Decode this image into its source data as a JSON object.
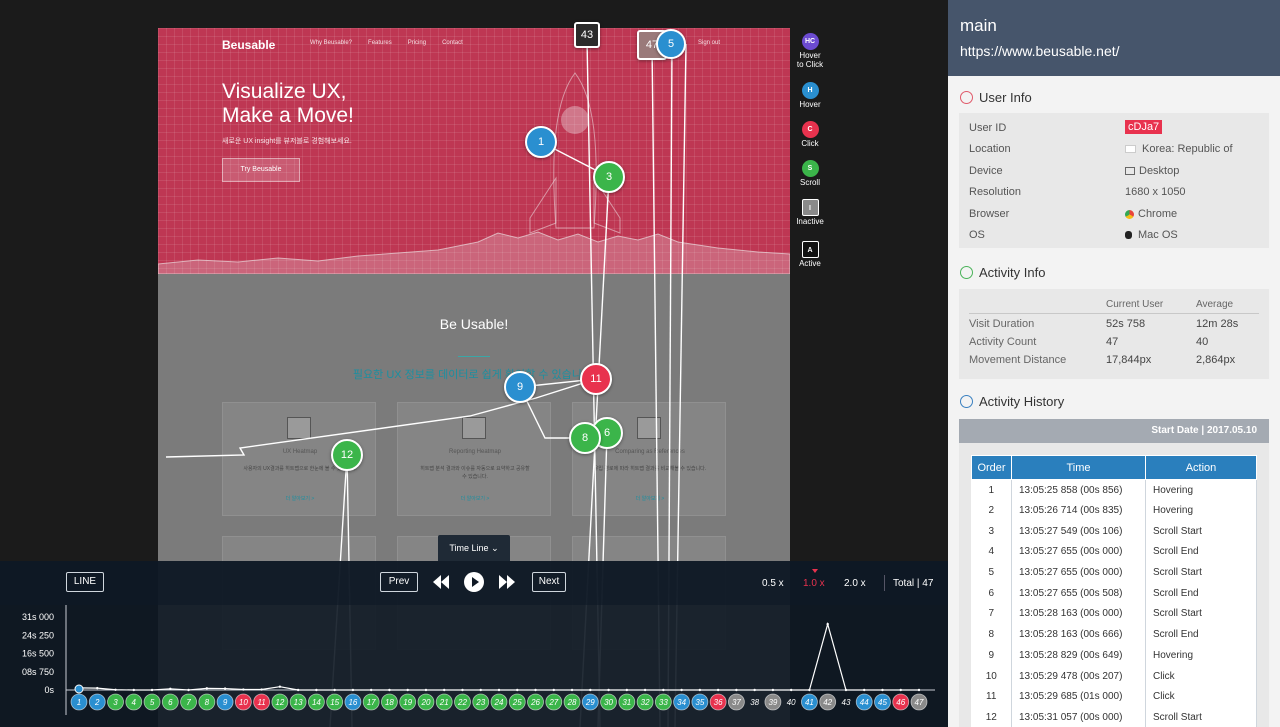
{
  "site": {
    "logo": "Beusable",
    "nav": [
      "Why Beusable?",
      "Features",
      "Pricing",
      "Contact"
    ],
    "signout": "Sign out",
    "hero_title": "Visualize UX,\nMake a Move!",
    "hero_sub": "새로운 UX insight를 뷰저블로 경험해보세요.",
    "hero_button": "Try Beusable",
    "section_title": "Be Usable!",
    "section_sub": "필요한 UX 정보를 데이터로 쉽게 확인할 수 있습니다.",
    "cards": [
      {
        "title": "UX Heatmap",
        "text": "사용자의 UX결과를 히트맵으로 한눈에 볼 수 있습니다.",
        "more": "더 알아보기 >"
      },
      {
        "title": "Reporting Heatmap",
        "text": "히트맵 분석 결과와 이슈를 자동으로 요약하고 공유할 수 있습니다.",
        "more": "더 알아보기 >"
      },
      {
        "title": "Comparing as References",
        "text": "유입 경로에 따라 히트맵 결과를 비교해볼 수 있습니다.",
        "more": "더 알아보기 >"
      }
    ]
  },
  "markers": [
    {
      "label": "43",
      "type": "inactive"
    },
    {
      "label": "47",
      "type": "inactive"
    },
    {
      "label": "5",
      "type": "hover"
    },
    {
      "label": "1",
      "type": "hover"
    },
    {
      "label": "3",
      "type": "scroll"
    },
    {
      "label": "9",
      "type": "hover"
    },
    {
      "label": "11",
      "type": "click"
    },
    {
      "label": "8",
      "type": "scroll"
    },
    {
      "label": "6",
      "type": "scroll"
    },
    {
      "label": "12",
      "type": "scroll"
    }
  ],
  "legend": [
    {
      "abbr": "HC",
      "label": "Hover\nto Click",
      "color": "#6c4bd1"
    },
    {
      "abbr": "H",
      "label": "Hover",
      "color": "#2a8fd0"
    },
    {
      "abbr": "C",
      "label": "Click",
      "color": "#e8324e"
    },
    {
      "abbr": "S",
      "label": "Scroll",
      "color": "#3bb54a"
    },
    {
      "abbr": "I",
      "label": "Inactive",
      "color": "#8a8a8a"
    },
    {
      "abbr": "A",
      "label": "Active",
      "color": "#111111"
    }
  ],
  "timeline": {
    "tab_label": "Time Line",
    "line_button": "LINE",
    "prev": "Prev",
    "next": "Next",
    "speeds": [
      "0.5 x",
      "1.0 x",
      "2.0 x"
    ],
    "total": "Total | 47",
    "y_ticks": [
      "31s 000",
      "24s 250",
      "16s 500",
      "08s 750",
      "0s"
    ]
  },
  "chart_data": {
    "type": "line",
    "title": "",
    "xlabel": "",
    "ylabel": "",
    "ylim": [
      0,
      31
    ],
    "x": [
      1,
      2,
      3,
      4,
      5,
      6,
      7,
      8,
      9,
      10,
      11,
      12,
      13,
      14,
      15,
      16,
      17,
      18,
      19,
      20,
      21,
      22,
      23,
      24,
      25,
      26,
      27,
      28,
      29,
      30,
      31,
      32,
      33,
      34,
      35,
      36,
      37,
      38,
      39,
      40,
      41,
      42,
      43,
      44,
      45,
      46,
      47
    ],
    "y_ticks": [
      "31s 000",
      "24s 250",
      "16s 500",
      "08s 750",
      "0s"
    ],
    "series": [
      {
        "values": [
          0.9,
          0.8,
          0.1,
          0,
          0,
          0.5,
          0,
          0.7,
          0.6,
          0.2,
          0.2,
          1.4,
          0,
          0,
          0,
          0,
          0,
          0,
          0,
          0,
          0,
          0,
          0,
          0,
          0,
          0,
          0,
          0,
          0,
          0,
          0,
          0,
          0,
          0,
          0,
          0,
          0,
          0,
          0,
          0,
          0,
          28,
          0,
          0,
          0,
          0,
          0
        ]
      }
    ],
    "points": [
      {
        "label": "1",
        "type": "hover"
      },
      {
        "label": "2",
        "type": "hover"
      },
      {
        "label": "3",
        "type": "scroll"
      },
      {
        "label": "4",
        "type": "scroll"
      },
      {
        "label": "5",
        "type": "scroll"
      },
      {
        "label": "6",
        "type": "scroll"
      },
      {
        "label": "7",
        "type": "scroll"
      },
      {
        "label": "8",
        "type": "scroll"
      },
      {
        "label": "9",
        "type": "hover"
      },
      {
        "label": "10",
        "type": "click"
      },
      {
        "label": "11",
        "type": "click"
      },
      {
        "label": "12",
        "type": "scroll"
      },
      {
        "label": "13",
        "type": "scroll"
      },
      {
        "label": "14",
        "type": "scroll"
      },
      {
        "label": "15",
        "type": "scroll"
      },
      {
        "label": "16",
        "type": "hover"
      },
      {
        "label": "17",
        "type": "scroll"
      },
      {
        "label": "18",
        "type": "scroll"
      },
      {
        "label": "19",
        "type": "scroll"
      },
      {
        "label": "20",
        "type": "scroll"
      },
      {
        "label": "21",
        "type": "scroll"
      },
      {
        "label": "22",
        "type": "scroll"
      },
      {
        "label": "23",
        "type": "scroll"
      },
      {
        "label": "24",
        "type": "scroll"
      },
      {
        "label": "25",
        "type": "scroll"
      },
      {
        "label": "26",
        "type": "scroll"
      },
      {
        "label": "27",
        "type": "scroll"
      },
      {
        "label": "28",
        "type": "scroll"
      },
      {
        "label": "29",
        "type": "hover"
      },
      {
        "label": "30",
        "type": "scroll"
      },
      {
        "label": "31",
        "type": "scroll"
      },
      {
        "label": "32",
        "type": "scroll"
      },
      {
        "label": "33",
        "type": "scroll"
      },
      {
        "label": "34",
        "type": "hover"
      },
      {
        "label": "35",
        "type": "hover"
      },
      {
        "label": "36",
        "type": "click"
      },
      {
        "label": "37",
        "type": "inactive"
      },
      {
        "label": "38",
        "type": "active"
      },
      {
        "label": "39",
        "type": "inactive"
      },
      {
        "label": "40",
        "type": "active"
      },
      {
        "label": "41",
        "type": "hover"
      },
      {
        "label": "42",
        "type": "inactive"
      },
      {
        "label": "43",
        "type": "active"
      },
      {
        "label": "44",
        "type": "hover"
      },
      {
        "label": "45",
        "type": "hover"
      },
      {
        "label": "46",
        "type": "click"
      },
      {
        "label": "47",
        "type": "inactive"
      }
    ]
  },
  "colors": {
    "hover": "#2a8fd0",
    "click": "#e8324e",
    "scroll": "#3bb54a",
    "inactive": "#8a8a8a",
    "active": "#111111",
    "hover_to_click": "#6c4bd1",
    "header": "#46556b",
    "table_head": "#2a7fbd"
  },
  "panel": {
    "title": "main",
    "url": "https://www.beusable.net/",
    "user_info": {
      "heading": "User Info",
      "rows": [
        {
          "label": "User ID",
          "value": "cDJa7"
        },
        {
          "label": "Location",
          "value": "Korea: Republic of"
        },
        {
          "label": "Device",
          "value": "Desktop"
        },
        {
          "label": "Resolution",
          "value": "1680 x 1050"
        },
        {
          "label": "Browser",
          "value": "Chrome"
        },
        {
          "label": "OS",
          "value": "Mac OS"
        }
      ]
    },
    "activity_info": {
      "heading": "Activity Info",
      "columns": [
        "Current User",
        "Average"
      ],
      "rows": [
        {
          "label": "Visit Duration",
          "current": "52s 758",
          "average": "12m 28s"
        },
        {
          "label": "Activity Count",
          "current": "47",
          "average": "40"
        },
        {
          "label": "Movement Distance",
          "current": "17,844px",
          "average": "2,864px"
        }
      ]
    },
    "activity_history": {
      "heading": "Activity History",
      "start_date": "Start Date | 2017.05.10",
      "columns": [
        "Order",
        "Time",
        "Action"
      ],
      "rows": [
        [
          "1",
          "13:05:25 858 (00s 856)",
          "Hovering"
        ],
        [
          "2",
          "13:05:26 714 (00s 835)",
          "Hovering"
        ],
        [
          "3",
          "13:05:27 549 (00s 106)",
          "Scroll Start"
        ],
        [
          "4",
          "13:05:27 655 (00s 000)",
          "Scroll End"
        ],
        [
          "5",
          "13:05:27 655 (00s 000)",
          "Scroll Start"
        ],
        [
          "6",
          "13:05:27 655 (00s 508)",
          "Scroll End"
        ],
        [
          "7",
          "13:05:28 163 (00s 000)",
          "Scroll Start"
        ],
        [
          "8",
          "13:05:28 163 (00s 666)",
          "Scroll End"
        ],
        [
          "9",
          "13:05:28 829 (00s 649)",
          "Hovering"
        ],
        [
          "10",
          "13:05:29 478 (00s 207)",
          "Click"
        ],
        [
          "11",
          "13:05:29 685 (01s 000)",
          "Click"
        ],
        [
          "12",
          "13:05:31 057 (00s 000)",
          "Scroll Start"
        ]
      ]
    }
  }
}
